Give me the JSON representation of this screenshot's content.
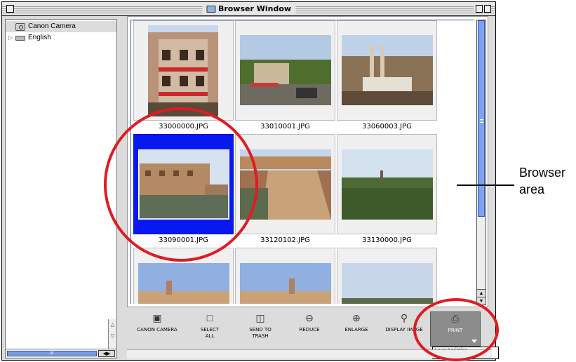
{
  "window": {
    "title": "Browser Window"
  },
  "tree": {
    "items": [
      {
        "label": "Canon Camera",
        "icon": "camera-icon",
        "selected": true
      },
      {
        "label": "English",
        "icon": "disk-icon",
        "selected": false,
        "expandable": true
      }
    ]
  },
  "thumbnails": [
    {
      "filename": "33000000.JPG",
      "selected": false
    },
    {
      "filename": "33010001.JPG",
      "selected": false
    },
    {
      "filename": "33060003.JPG",
      "selected": false
    },
    {
      "filename": "33090001.JPG",
      "selected": true
    },
    {
      "filename": "33120102.JPG",
      "selected": false
    },
    {
      "filename": "33130000.JPG",
      "selected": false
    },
    {
      "filename": "",
      "selected": false
    },
    {
      "filename": "",
      "selected": false
    },
    {
      "filename": "",
      "selected": false
    }
  ],
  "toolbar": {
    "canon_camera": "CANON CAMERA",
    "select_all_1": "SELECT",
    "select_all_2": "ALL",
    "send_to_trash_1": "SEND TO",
    "send_to_trash_2": "TRASH",
    "reduce": "REDUCE",
    "enlarge": "ENLARGE",
    "display_image": "DISPLAY IMAGE",
    "print": "PRINT",
    "print_tooltip": "Layout printing"
  },
  "callout": {
    "line1": "Browser",
    "line2": "area"
  },
  "colors": {
    "selection": "#0818f2",
    "highlight_ring": "#e01b22",
    "scroll_thumb": "#7fa2ee"
  }
}
